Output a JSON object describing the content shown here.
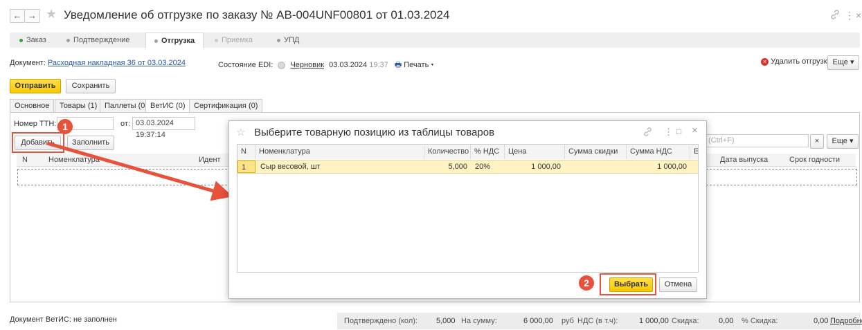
{
  "title_bar": {
    "back_glyph": "←",
    "forward_glyph": "→",
    "title": "Уведомление об отгрузке по заказу № АВ-004UNF00801 от 01.03.2024",
    "link_icon": "link-icon",
    "more_icon": "more-vert-icon",
    "close_glyph": "×"
  },
  "stages": [
    {
      "label": "Заказ",
      "state": "done"
    },
    {
      "label": "Подтверждение",
      "state": "normal"
    },
    {
      "label": "Отгрузка",
      "state": "active"
    },
    {
      "label": "Приемка",
      "state": "dim"
    },
    {
      "label": "УПД",
      "state": "normal"
    }
  ],
  "document_line": {
    "doc_label": "Документ:",
    "doc_link": "Расходная накладная 36 от 03.03.2024",
    "edi_label": "Состояние EDI:",
    "edi_status": "Черновик",
    "edi_date": "03.03.2024",
    "edi_time": "19:37",
    "print_label": "Печать",
    "delete_label": "Удалить отгрузку",
    "more_label": "Еще"
  },
  "toolbar": {
    "send_label": "Отправить",
    "save_label": "Сохранить"
  },
  "tabs": [
    {
      "label": "Основное"
    },
    {
      "label": "Товары (1)"
    },
    {
      "label": "Паллеты (0)"
    },
    {
      "label": "ВетИС (0)"
    },
    {
      "label": "Сертификация (0)"
    }
  ],
  "vetis": {
    "ttn_label": "Номер ТТН:",
    "from_label": "от:",
    "from_value": "03.03.2024 19:37:14",
    "add_label": "Добавить",
    "fill_label": "Заполнить",
    "search_placeholder": "(Ctrl+F)",
    "clear_glyph": "×",
    "more_label": "Еще",
    "columns": [
      "N",
      "Номенклатура",
      "Идент",
      "Дата выпуска",
      "Срок годности"
    ]
  },
  "dialog": {
    "title": "Выберите товарную позицию из таблицы товаров",
    "columns": [
      "N",
      "Номенклатура",
      "Количество",
      "% НДС",
      "Цена",
      "Сумма скидки",
      "Сумма НДС",
      "Е"
    ],
    "rows": [
      {
        "n": "1",
        "name": "Сыр весовой, шт",
        "qty": "5,000",
        "vat": "20%",
        "price": "1 000,00",
        "discount": "",
        "vat_sum": "1 000,00"
      }
    ],
    "choose_label": "Выбрать",
    "cancel_label": "Отмена"
  },
  "annotations": {
    "step1": "1",
    "step2": "2",
    "color": "#e8523a"
  },
  "footer": {
    "vetis_label": "Документ ВетИС:",
    "vetis_value": "не заполнен",
    "confirmed_label": "Подтверждено (кол):",
    "confirmed_value": "5,000",
    "sum_label": "На сумму:",
    "sum_value": "6 000,00",
    "currency": "руб",
    "vat_label": "НДС (в т.ч):",
    "vat_value": "1 000,00",
    "discount_label": "Скидка:",
    "discount_value": "0,00",
    "pct_discount_label": "% Скидка:",
    "pct_discount_value": "0,00",
    "details_label": "Подробно"
  }
}
